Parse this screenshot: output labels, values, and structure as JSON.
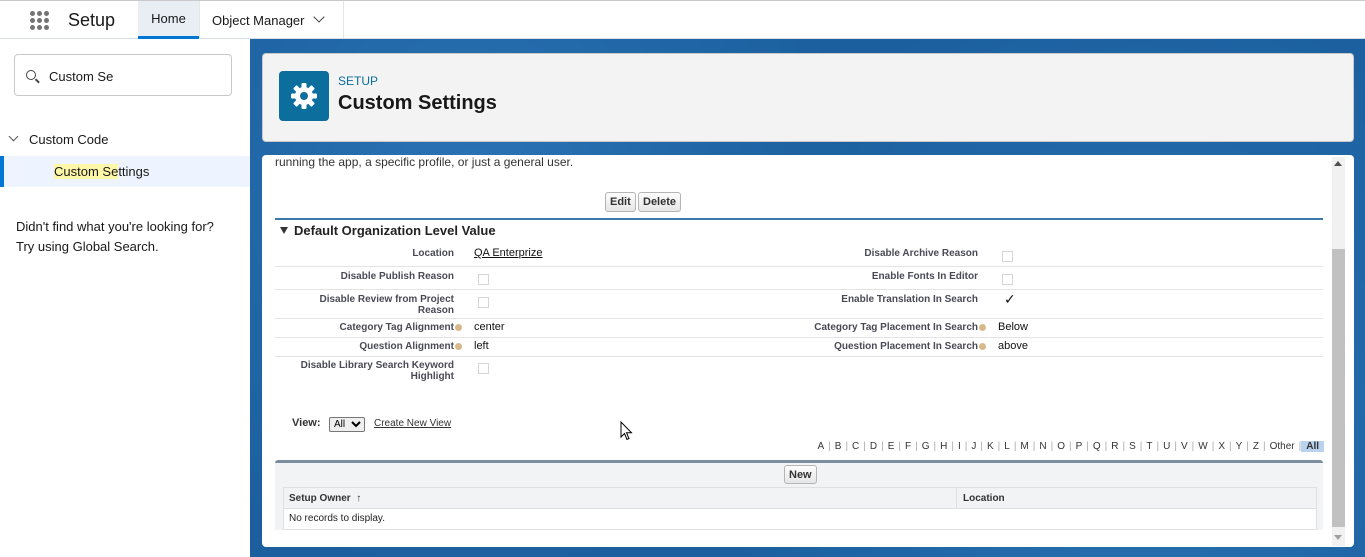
{
  "topbar": {
    "app_name": "Setup",
    "tabs": [
      {
        "label": "Home"
      },
      {
        "label": "Object Manager"
      }
    ]
  },
  "sidebar": {
    "search": {
      "value": "Custom Se"
    },
    "group_label": "Custom Code",
    "item": {
      "label_match": "Custom Se",
      "label_rest": "ttings"
    },
    "help_line1": "Didn't find what you're looking for?",
    "help_line2": "Try using Global Search."
  },
  "header": {
    "breadcrumb": "SETUP",
    "title": "Custom Settings"
  },
  "detail": {
    "intro_text": "running the app, a specific profile, or just a general user.",
    "buttons": {
      "edit": "Edit",
      "delete": "Delete"
    },
    "section_title": "Default Organization Level Value",
    "fields": {
      "location": {
        "label": "Location",
        "value": "QA Enterprize"
      },
      "disable_archive_reason": {
        "label": "Disable Archive Reason",
        "checked": false
      },
      "disable_publish_reason": {
        "label": "Disable Publish Reason",
        "checked": false
      },
      "enable_fonts_in_editor": {
        "label": "Enable Fonts In Editor",
        "checked": false
      },
      "disable_review_line1": "Disable Review from Project",
      "disable_review_line2": "Reason",
      "enable_translation_in_search": {
        "label": "Enable Translation In Search",
        "checked": true,
        "mark": "✓"
      },
      "category_tag_alignment": {
        "label": "Category Tag Alignment",
        "value": "center"
      },
      "category_tag_placement": {
        "label": "Category Tag Placement In Search",
        "value": "Below"
      },
      "question_alignment": {
        "label": "Question Alignment",
        "value": "left"
      },
      "question_placement": {
        "label": "Question Placement In Search",
        "value": "above"
      },
      "disable_library_line1": "Disable Library Search Keyword",
      "disable_library_line2": "Highlight"
    }
  },
  "list_view": {
    "view_label": "View:",
    "view_selected": "All",
    "create_new_view": "Create New View",
    "alphabet": [
      "A",
      "B",
      "C",
      "D",
      "E",
      "F",
      "G",
      "H",
      "I",
      "J",
      "K",
      "L",
      "M",
      "N",
      "O",
      "P",
      "Q",
      "R",
      "S",
      "T",
      "U",
      "V",
      "W",
      "X",
      "Y",
      "Z",
      "Other"
    ],
    "alphabet_all": "All",
    "new_button": "New",
    "columns": {
      "owner": "Setup Owner",
      "owner_sort": "↑",
      "location": "Location"
    },
    "empty_message": "No records to display."
  }
}
